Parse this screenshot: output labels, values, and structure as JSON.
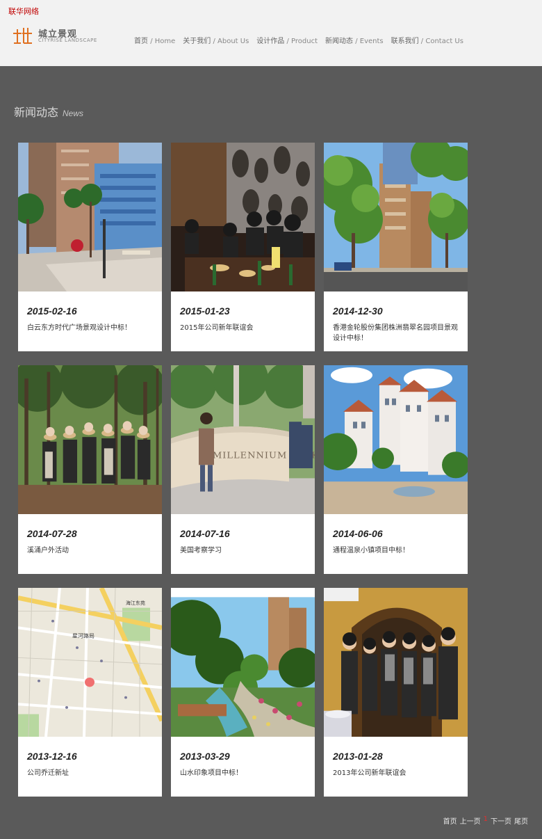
{
  "site": {
    "brand_link": "联华网络",
    "logo_cn": "城立景观",
    "logo_en": "CITYRISE LANDSCAPE"
  },
  "nav": [
    {
      "cn": "首页",
      "en": "/ Home"
    },
    {
      "cn": "关于我们",
      "en": "/ About Us"
    },
    {
      "cn": "设计作品",
      "en": "/ Product"
    },
    {
      "cn": "新闻动态",
      "en": "/ Events"
    },
    {
      "cn": "联系我们",
      "en": "/ Contact Us"
    }
  ],
  "section": {
    "title_cn": "新闻动态",
    "title_en": "News"
  },
  "news": [
    {
      "date": "2015-02-16",
      "caption": "白云东方时代广场景观设计中标！",
      "image": "plaza-rendering"
    },
    {
      "date": "2015-01-23",
      "caption": "2015年公司新年联谊会",
      "image": "dinner-party"
    },
    {
      "date": "2014-12-30",
      "caption": "香港金轮股份集团株洲翡翠名园项目景观设计中标！",
      "image": "street-trees"
    },
    {
      "date": "2014-07-28",
      "caption": "溪涌户外活动",
      "image": "forest-group"
    },
    {
      "date": "2014-07-16",
      "caption": "美国考察学习",
      "image": "millennium-park"
    },
    {
      "date": "2014-06-06",
      "caption": "通程温泉小镇项目中标！",
      "image": "town-rendering"
    },
    {
      "date": "2013-12-16",
      "caption": "公司乔迁新址",
      "image": "street-map"
    },
    {
      "date": "2013-03-29",
      "caption": "山水印象项目中标！",
      "image": "garden-rendering"
    },
    {
      "date": "2013-01-28",
      "caption": "2013年公司新年联谊会",
      "image": "group-photo"
    }
  ],
  "map_labels": {
    "district": "星河路局",
    "place": "海江东苑"
  },
  "park_sign": "MILLENNIUM PARK",
  "pager": {
    "first": "首页",
    "prev": "上一页",
    "current": "1",
    "next": "下一页",
    "last": "尾页"
  }
}
